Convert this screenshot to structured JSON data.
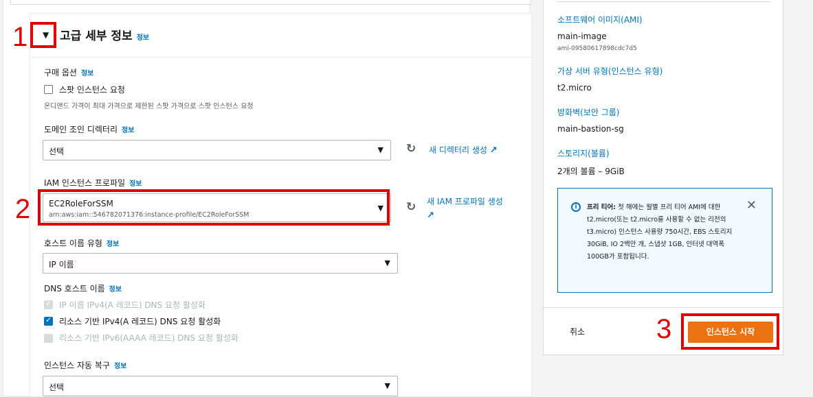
{
  "advanced": {
    "title": "고급 세부 정보",
    "info": "정보"
  },
  "purchase": {
    "label": "구매 옵션",
    "info": "정보",
    "spot_label": "스팟 인스턴스 요청",
    "spot_desc": "온디맨드 가격이 최대 가격으로 제한된 스팟 가격으로 스팟 인스턴스 요청"
  },
  "domain": {
    "label": "도메인 조인 디렉터리",
    "info": "정보",
    "value": "선택",
    "create_link": "새 디렉터리 생성"
  },
  "iam": {
    "label": "IAM 인스턴스 프로파일",
    "info": "정보",
    "value": "EC2RoleForSSM",
    "arn": "arn:aws:iam::546782071376:instance-profile/EC2RoleForSSM",
    "create_link_1": "새 IAM 프로파일 생성"
  },
  "hostname": {
    "label": "호스트 이름 유형",
    "info": "정보",
    "value": "IP 이름"
  },
  "dns": {
    "label": "DNS 호스트 이름",
    "info": "정보",
    "opt1": "IP 이름 IPv4(A 레코드) DNS 요청 활성화",
    "opt2": "리소스 기반 IPv4(A 레코드) DNS 요청 활성화",
    "opt3": "리소스 기반 IPv6(AAAA 레코드) DNS 요청 활성화"
  },
  "recovery": {
    "label": "인스턴스 자동 복구",
    "info": "정보",
    "value": "선택"
  },
  "summary": {
    "ami_label": "소프트웨어 이미지(AMI)",
    "ami_name": "main-image",
    "ami_id": "ami-09580617898cdc7d5",
    "type_label": "가상 서버 유형(인스턴스 유형)",
    "type_value": "t2.micro",
    "sg_label": "방화벽(보안 그룹)",
    "sg_value": "main-bastion-sg",
    "storage_label": "스토리지(볼륨)",
    "storage_value": "2개의 볼륨 – 9GiB",
    "notice_bold": "프리 티어:",
    "notice_text": " 첫 해에는 월별 프리 티어 AMI에 대한 t2.micro(또는 t2.micro를 사용할 수 없는 리전의 t3.micro) 인스턴스 사용량 750시간, EBS 스토리지 30GiB, IO 2백만 개, 스냅샷 1GB, 인터넷 대역폭 100GB가 포함됩니다.",
    "cancel": "취소",
    "launch": "인스턴스 시작"
  },
  "annotations": {
    "n1": "1",
    "n2": "2",
    "n3": "3"
  }
}
